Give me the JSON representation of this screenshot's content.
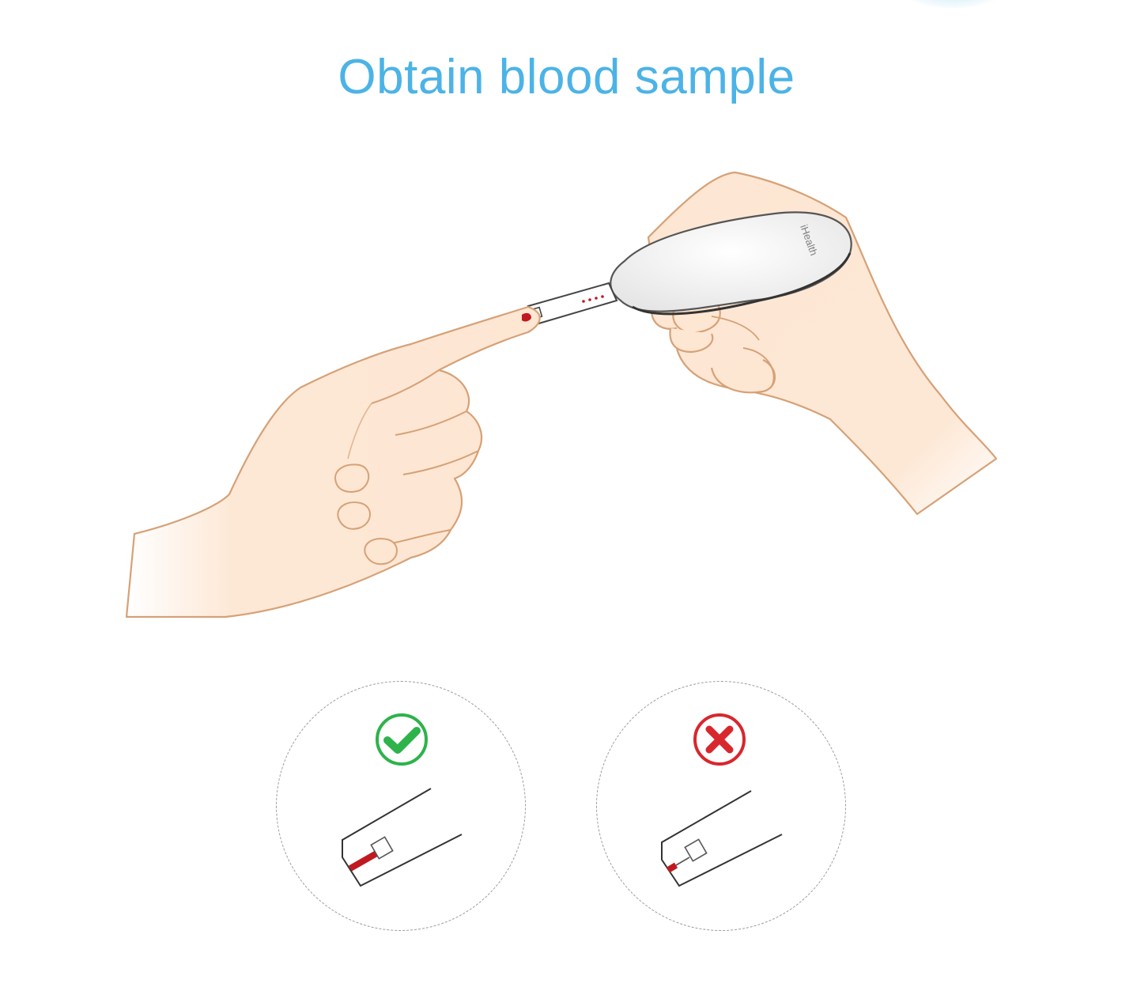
{
  "page": {
    "title": "Obtain blood sample"
  },
  "device": {
    "brand": "iHealth"
  },
  "examples": [
    {
      "status": "correct",
      "icon": "check-icon",
      "color": "#2db34a"
    },
    {
      "status": "incorrect",
      "icon": "cross-icon",
      "color": "#d8272d"
    }
  ],
  "colors": {
    "title": "#4cb3e6",
    "blood": "#c0191f",
    "skin_fill": "#fde6d2",
    "skin_outline": "#d6a177",
    "device_outline": "#555555"
  }
}
